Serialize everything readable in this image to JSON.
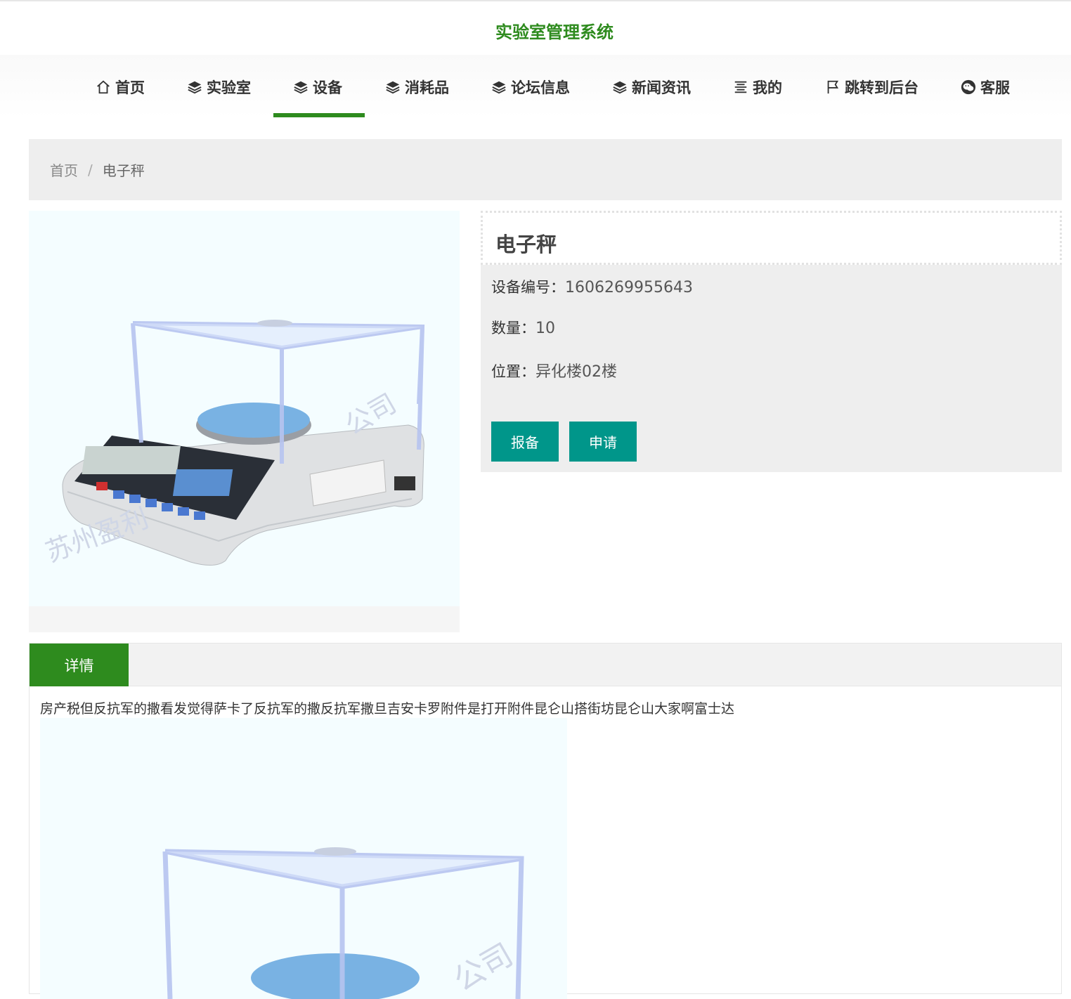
{
  "header": {
    "site_title": "实验室管理系统"
  },
  "nav": {
    "items": [
      {
        "label": "首页",
        "icon": "home-icon"
      },
      {
        "label": "实验室",
        "icon": "layers-icon"
      },
      {
        "label": "设备",
        "icon": "layers-icon",
        "active": true
      },
      {
        "label": "消耗品",
        "icon": "layers-icon"
      },
      {
        "label": "论坛信息",
        "icon": "layers-icon"
      },
      {
        "label": "新闻资讯",
        "icon": "layers-icon"
      },
      {
        "label": "我的",
        "icon": "list-icon"
      },
      {
        "label": "跳转到后台",
        "icon": "flag-icon"
      },
      {
        "label": "客服",
        "icon": "wechat-icon"
      }
    ]
  },
  "breadcrumb": {
    "home": "首页",
    "separator": "/",
    "current": "电子秤"
  },
  "product": {
    "title": "电子秤",
    "fields": [
      {
        "label": "设备编号：",
        "value": "1606269955643"
      },
      {
        "label": "数量：",
        "value": "10"
      },
      {
        "label": "位置：",
        "value": "异化楼02楼"
      }
    ],
    "buttons": {
      "report": "报备",
      "apply": "申请"
    }
  },
  "details": {
    "tab_label": "详情",
    "text": "房产税但反抗军的撒看发觉得萨卡了反抗军的撒反抗军撒旦吉安卡罗附件是打开附件昆仑山搭街坊昆仑山大家啊富士达"
  },
  "colors": {
    "brand_green": "#2e8b1e",
    "button_teal": "#00968a",
    "panel_gray": "#eeeeee"
  }
}
